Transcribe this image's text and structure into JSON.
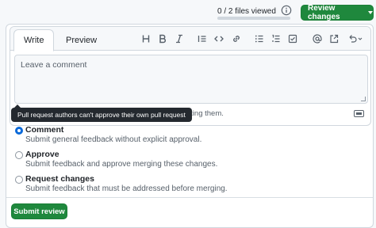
{
  "header": {
    "files_viewed": "0 / 2 files viewed",
    "files_viewed_progress": 0,
    "review_button_label": "Review changes"
  },
  "editor": {
    "tabs": [
      {
        "label": "Write",
        "active": true
      },
      {
        "label": "Preview",
        "active": false
      }
    ],
    "toolbar_icons": [
      "heading-icon",
      "bold-icon",
      "italic-icon",
      "quote-icon",
      "code-icon",
      "link-icon",
      "unordered-list-icon",
      "ordered-list-icon",
      "task-list-icon",
      "mention-icon",
      "reference-icon",
      "undo-menu-icon"
    ],
    "placeholder": "Leave a comment",
    "attach_text": "Attach files by dragging & dropping, selecting or pasting them."
  },
  "options": [
    {
      "label": "Comment",
      "description": "Submit general feedback without explicit approval.",
      "checked": true
    },
    {
      "label": "Approve",
      "description": "Submit feedback and approve merging these changes.",
      "checked": false
    },
    {
      "label": "Request changes",
      "description": "Submit feedback that must be addressed before merging.",
      "checked": false
    }
  ],
  "tooltip": "Pull request authors can't approve their own pull request",
  "submit_label": "Submit review",
  "colors": {
    "primary_green": "#1f883d",
    "selected_blue": "#0969da",
    "tooltip_bg": "#24292f"
  }
}
